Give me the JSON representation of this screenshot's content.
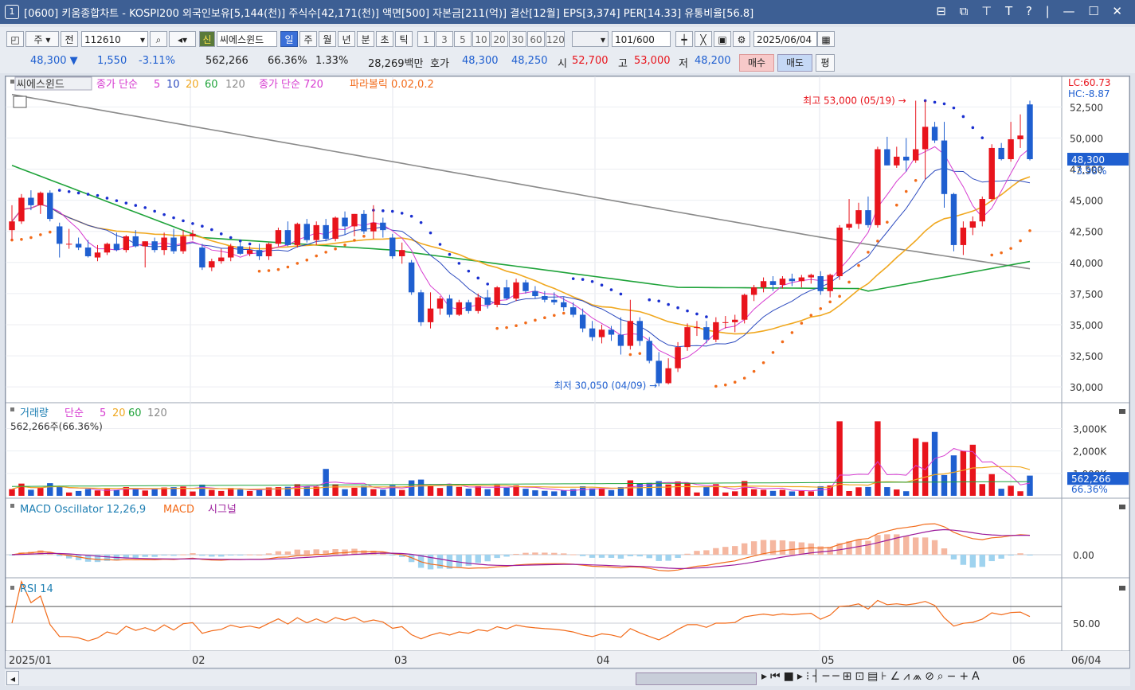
{
  "window": {
    "number": "1",
    "title": "[0600] 키움종합차트 - KOSPI200 외국인보유[5,144(천)] 주식수[42,171(천)] 액면[500] 자본금[211(억)] 결산[12월] EPS[3,374] PER[14.33] 유통비율[56.8]",
    "controls": "⊟ ⧉ ⊤ T ? | — ☐ ✕"
  },
  "toolbar": {
    "period_type": "주",
    "market_label": "전",
    "code": "112610",
    "new_label": "신",
    "stock_name": "씨에스윈드",
    "period_buttons": [
      "일",
      "주",
      "월",
      "년",
      "분",
      "초",
      "틱"
    ],
    "selected_period": "일",
    "interval_buttons": [
      "1",
      "3",
      "5",
      "10",
      "20",
      "30",
      "60",
      "120"
    ],
    "count": "101",
    "count_max": "/600",
    "date": "2025/06/04"
  },
  "quote": {
    "price": "48,300",
    "arrow": "▼",
    "change": "1,550",
    "change_pct": "-3.11%",
    "volume": "562,266",
    "volume_ratio": "66.36%",
    "turnover": "1.33%",
    "amount": "28,269백만",
    "ask_label": "호가",
    "ask": "48,300",
    "bid": "48,250",
    "open_label": "시",
    "open": "52,700",
    "high_label": "고",
    "high": "53,000",
    "low_label": "저",
    "low": "48,200",
    "buy_label": "매수",
    "sell_label": "매도",
    "eval_label": "평"
  },
  "legends": {
    "price": {
      "name": "씨에스윈드",
      "ma_label": "종가 단순",
      "ma_periods": [
        "5",
        "10",
        "20",
        "60",
        "120"
      ],
      "ma2_label": "종가 단순 720",
      "sar_label": "파라볼릭 0.02,0.2"
    },
    "volume": {
      "label": "거래량",
      "ma_label": "단순",
      "ma_periods": [
        "5",
        "20",
        "60",
        "120"
      ],
      "current": "562,266주(66.36%)"
    },
    "macd": {
      "label": "MACD Oscillator 12,26,9",
      "macd": "MACD",
      "signal": "시그널"
    },
    "rsi": {
      "label": "RSI 14"
    }
  },
  "annotations": {
    "high": "최고 53,000 (05/19) →",
    "low": "최저 30,050 (04/09) →",
    "lc": "LC:60.73",
    "hc": "HC:-8.87",
    "price_tag": "48,300",
    "price_pct": "-3.98%",
    "vol_tag": "562,266",
    "vol_pct": "66.36%"
  },
  "colors": {
    "up": "#e8141c",
    "down": "#1f5fd0",
    "ma5": "#d63bd0",
    "ma10": "#2d4bbf",
    "ma20": "#f0a820",
    "ma60": "#1fa33a",
    "ma120": "#8a8a8a",
    "sar_up": "#f26b1a",
    "sar_down": "#1a2fd0"
  },
  "chart_data": {
    "type": "candlestick",
    "x_axis": {
      "month_labels": [
        "2025/01",
        "02",
        "03",
        "04",
        "05",
        "06"
      ],
      "end_label": "06/04"
    },
    "price_axis": {
      "ticks": [
        "52,500",
        "50,000",
        "47,500",
        "45,000",
        "42,500",
        "40,000",
        "37,500",
        "35,000",
        "32,500",
        "30,000"
      ],
      "ylim": [
        29500,
        53800
      ]
    },
    "volume_axis": {
      "ticks": [
        "3,000K",
        "2,000K",
        "1,000K"
      ]
    },
    "macd_axis": {
      "ticks": [
        "0.00"
      ]
    },
    "rsi_axis": {
      "ticks": [
        "50.00"
      ]
    },
    "candles": [
      {
        "o": 42600,
        "h": 44600,
        "l": 41800,
        "c": 43300
      },
      {
        "o": 43300,
        "h": 45500,
        "l": 43100,
        "c": 45200
      },
      {
        "o": 45200,
        "h": 45800,
        "l": 44200,
        "c": 44600
      },
      {
        "o": 44600,
        "h": 45700,
        "l": 43900,
        "c": 45600
      },
      {
        "o": 45600,
        "h": 45800,
        "l": 43300,
        "c": 43500
      },
      {
        "o": 42900,
        "h": 43200,
        "l": 40400,
        "c": 41500
      },
      {
        "o": 41500,
        "h": 42700,
        "l": 41100,
        "c": 41500
      },
      {
        "o": 41500,
        "h": 42000,
        "l": 41000,
        "c": 41200
      },
      {
        "o": 41200,
        "h": 41800,
        "l": 40400,
        "c": 40500
      },
      {
        "o": 40400,
        "h": 41400,
        "l": 40100,
        "c": 40800
      },
      {
        "o": 40800,
        "h": 41600,
        "l": 40600,
        "c": 41500
      },
      {
        "o": 41500,
        "h": 42400,
        "l": 40900,
        "c": 41000
      },
      {
        "o": 41000,
        "h": 42200,
        "l": 40800,
        "c": 42100
      },
      {
        "o": 42100,
        "h": 42600,
        "l": 41200,
        "c": 41300
      },
      {
        "o": 41300,
        "h": 41700,
        "l": 39600,
        "c": 41700
      },
      {
        "o": 41700,
        "h": 42000,
        "l": 40800,
        "c": 41000
      },
      {
        "o": 41000,
        "h": 42400,
        "l": 40600,
        "c": 42000
      },
      {
        "o": 42000,
        "h": 42700,
        "l": 40700,
        "c": 40900
      },
      {
        "o": 40900,
        "h": 42600,
        "l": 40700,
        "c": 42100
      },
      {
        "o": 42100,
        "h": 42600,
        "l": 41800,
        "c": 42300
      },
      {
        "o": 41200,
        "h": 41500,
        "l": 39400,
        "c": 39600
      },
      {
        "o": 39600,
        "h": 40300,
        "l": 39300,
        "c": 40100
      },
      {
        "o": 40100,
        "h": 41100,
        "l": 39900,
        "c": 40400
      },
      {
        "o": 40400,
        "h": 41500,
        "l": 40100,
        "c": 41300
      },
      {
        "o": 41300,
        "h": 41700,
        "l": 40600,
        "c": 40700
      },
      {
        "o": 40700,
        "h": 41300,
        "l": 40500,
        "c": 41000
      },
      {
        "o": 41000,
        "h": 41500,
        "l": 40200,
        "c": 40500
      },
      {
        "o": 40500,
        "h": 41600,
        "l": 40200,
        "c": 41500
      },
      {
        "o": 41500,
        "h": 42800,
        "l": 41300,
        "c": 42600
      },
      {
        "o": 42600,
        "h": 43300,
        "l": 41300,
        "c": 41400
      },
      {
        "o": 41400,
        "h": 43200,
        "l": 41200,
        "c": 43100
      },
      {
        "o": 43100,
        "h": 43500,
        "l": 41600,
        "c": 41800
      },
      {
        "o": 41800,
        "h": 43300,
        "l": 41400,
        "c": 43000
      },
      {
        "o": 43000,
        "h": 43500,
        "l": 41700,
        "c": 41900
      },
      {
        "o": 41900,
        "h": 43700,
        "l": 41700,
        "c": 43600
      },
      {
        "o": 43600,
        "h": 44100,
        "l": 42200,
        "c": 42900
      },
      {
        "o": 42900,
        "h": 43900,
        "l": 42100,
        "c": 43900
      },
      {
        "o": 43900,
        "h": 44200,
        "l": 42300,
        "c": 42500
      },
      {
        "o": 42500,
        "h": 44600,
        "l": 41900,
        "c": 43200
      },
      {
        "o": 43200,
        "h": 43600,
        "l": 42000,
        "c": 42600
      },
      {
        "o": 42000,
        "h": 42300,
        "l": 40300,
        "c": 40500
      },
      {
        "o": 40500,
        "h": 41600,
        "l": 39900,
        "c": 41000
      },
      {
        "o": 40000,
        "h": 40200,
        "l": 37400,
        "c": 37600
      },
      {
        "o": 37600,
        "h": 37800,
        "l": 34900,
        "c": 35200
      },
      {
        "o": 35200,
        "h": 37600,
        "l": 34700,
        "c": 36300
      },
      {
        "o": 36300,
        "h": 37300,
        "l": 35800,
        "c": 37100
      },
      {
        "o": 37100,
        "h": 37400,
        "l": 35600,
        "c": 35800
      },
      {
        "o": 35800,
        "h": 37000,
        "l": 35700,
        "c": 36800
      },
      {
        "o": 36800,
        "h": 37000,
        "l": 35900,
        "c": 36100
      },
      {
        "o": 36100,
        "h": 37500,
        "l": 35900,
        "c": 37200
      },
      {
        "o": 37200,
        "h": 37800,
        "l": 36300,
        "c": 36600
      },
      {
        "o": 36600,
        "h": 38100,
        "l": 36400,
        "c": 38000
      },
      {
        "o": 38000,
        "h": 38600,
        "l": 37000,
        "c": 37100
      },
      {
        "o": 37100,
        "h": 38700,
        "l": 36900,
        "c": 38400
      },
      {
        "o": 38400,
        "h": 38600,
        "l": 37500,
        "c": 37700
      },
      {
        "o": 37700,
        "h": 38100,
        "l": 37100,
        "c": 37300
      },
      {
        "o": 37300,
        "h": 37700,
        "l": 36800,
        "c": 37000
      },
      {
        "o": 37000,
        "h": 37600,
        "l": 36600,
        "c": 36800
      },
      {
        "o": 36800,
        "h": 37200,
        "l": 36100,
        "c": 36400
      },
      {
        "o": 36400,
        "h": 36800,
        "l": 35600,
        "c": 35800
      },
      {
        "o": 35800,
        "h": 36300,
        "l": 34400,
        "c": 34700
      },
      {
        "o": 34700,
        "h": 35300,
        "l": 33700,
        "c": 34000
      },
      {
        "o": 34000,
        "h": 35000,
        "l": 33500,
        "c": 34600
      },
      {
        "o": 34600,
        "h": 34900,
        "l": 33700,
        "c": 34200
      },
      {
        "o": 34200,
        "h": 35600,
        "l": 32600,
        "c": 33300
      },
      {
        "o": 33300,
        "h": 37000,
        "l": 33000,
        "c": 35300
      },
      {
        "o": 35300,
        "h": 35600,
        "l": 33300,
        "c": 33700
      },
      {
        "o": 33700,
        "h": 34000,
        "l": 31900,
        "c": 32100
      },
      {
        "o": 32100,
        "h": 32800,
        "l": 30050,
        "c": 30300
      },
      {
        "o": 30300,
        "h": 32300,
        "l": 30200,
        "c": 31500
      },
      {
        "o": 31500,
        "h": 33600,
        "l": 31200,
        "c": 33200
      },
      {
        "o": 33200,
        "h": 35100,
        "l": 32900,
        "c": 34800
      },
      {
        "o": 34800,
        "h": 35300,
        "l": 34100,
        "c": 34800
      },
      {
        "o": 34800,
        "h": 35300,
        "l": 33500,
        "c": 33800
      },
      {
        "o": 33800,
        "h": 35600,
        "l": 33600,
        "c": 35200
      },
      {
        "o": 35200,
        "h": 35700,
        "l": 34700,
        "c": 35200
      },
      {
        "o": 35200,
        "h": 35800,
        "l": 34400,
        "c": 35400
      },
      {
        "o": 35400,
        "h": 37500,
        "l": 35100,
        "c": 37400
      },
      {
        "o": 37400,
        "h": 38200,
        "l": 36900,
        "c": 38000
      },
      {
        "o": 38000,
        "h": 38800,
        "l": 37600,
        "c": 38500
      },
      {
        "o": 38500,
        "h": 38900,
        "l": 37700,
        "c": 38200
      },
      {
        "o": 38200,
        "h": 38900,
        "l": 37900,
        "c": 38700
      },
      {
        "o": 38700,
        "h": 39100,
        "l": 38100,
        "c": 38500
      },
      {
        "o": 38500,
        "h": 39000,
        "l": 38000,
        "c": 38800
      },
      {
        "o": 38800,
        "h": 39100,
        "l": 38300,
        "c": 39000
      },
      {
        "o": 38900,
        "h": 39300,
        "l": 37400,
        "c": 37700
      },
      {
        "o": 37700,
        "h": 39100,
        "l": 37200,
        "c": 39000
      },
      {
        "o": 38900,
        "h": 43000,
        "l": 38600,
        "c": 42800
      },
      {
        "o": 42800,
        "h": 45100,
        "l": 42600,
        "c": 43100
      },
      {
        "o": 43100,
        "h": 44800,
        "l": 42700,
        "c": 44200
      },
      {
        "o": 44200,
        "h": 45300,
        "l": 42800,
        "c": 43000
      },
      {
        "o": 43000,
        "h": 49300,
        "l": 42800,
        "c": 49100
      },
      {
        "o": 49100,
        "h": 50100,
        "l": 47800,
        "c": 47800
      },
      {
        "o": 47800,
        "h": 49300,
        "l": 47600,
        "c": 48500
      },
      {
        "o": 48500,
        "h": 50000,
        "l": 47300,
        "c": 48200
      },
      {
        "o": 48200,
        "h": 53000,
        "l": 48000,
        "c": 49100
      },
      {
        "o": 49100,
        "h": 53000,
        "l": 46700,
        "c": 50900
      },
      {
        "o": 50900,
        "h": 51300,
        "l": 49600,
        "c": 49800
      },
      {
        "o": 49800,
        "h": 51300,
        "l": 44400,
        "c": 45500
      },
      {
        "o": 45500,
        "h": 45600,
        "l": 40900,
        "c": 41400
      },
      {
        "o": 41400,
        "h": 43300,
        "l": 40600,
        "c": 42800
      },
      {
        "o": 42800,
        "h": 43700,
        "l": 42200,
        "c": 43300
      },
      {
        "o": 43300,
        "h": 45300,
        "l": 42900,
        "c": 45100
      },
      {
        "o": 45100,
        "h": 49500,
        "l": 44900,
        "c": 49200
      },
      {
        "o": 49200,
        "h": 49600,
        "l": 48200,
        "c": 48300
      },
      {
        "o": 48300,
        "h": 51300,
        "l": 48100,
        "c": 49900
      },
      {
        "o": 49900,
        "h": 51900,
        "l": 49200,
        "c": 50200
      },
      {
        "o": 52700,
        "h": 53000,
        "l": 48200,
        "c": 48300
      }
    ]
  }
}
